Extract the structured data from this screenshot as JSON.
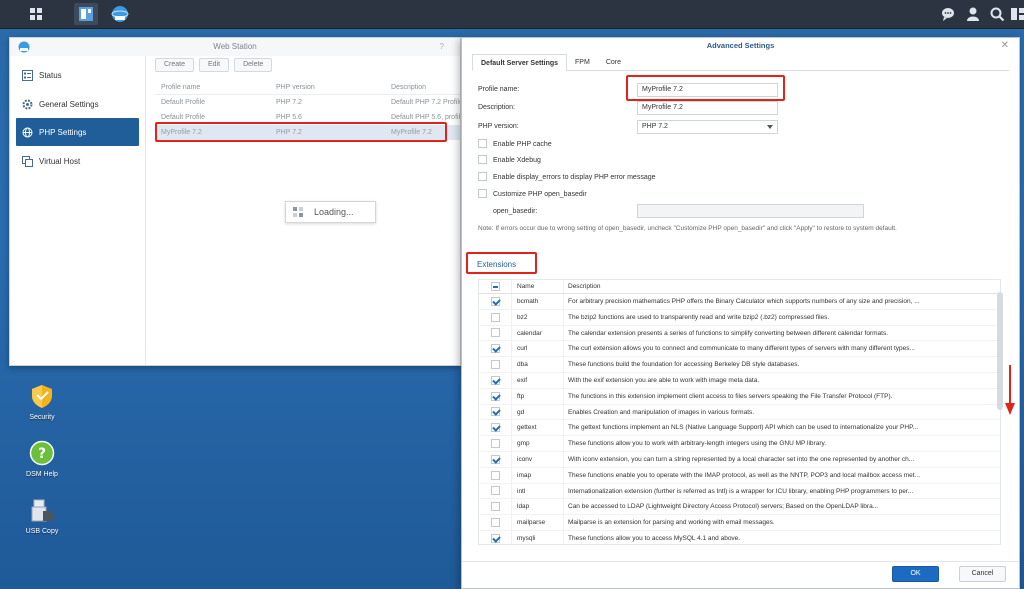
{
  "desktop": {
    "icons": [
      {
        "label": "Security"
      },
      {
        "label": "DSM Help"
      },
      {
        "label": "USB Copy"
      }
    ]
  },
  "web_station": {
    "title": "Web Station",
    "sidebar": [
      {
        "label": "Status"
      },
      {
        "label": "General Settings"
      },
      {
        "label": "PHP Settings"
      },
      {
        "label": "Virtual Host"
      }
    ],
    "toolbar": {
      "create": "Create",
      "edit": "Edit",
      "delete": "Delete"
    },
    "columns": [
      "Profile name",
      "PHP version",
      "Description"
    ],
    "rows": [
      [
        "Default Profile",
        "PHP 7.2",
        "Default PHP 7.2 Profile"
      ],
      [
        "Default Profile",
        "PHP 5.6",
        "Default PHP 5.6, profile"
      ],
      [
        "MyProfile 7.2",
        "PHP 7.2",
        "MyProfile 7.2"
      ]
    ],
    "loading": "Loading..."
  },
  "advanced": {
    "title": "Advanced Settings",
    "tabs": [
      "Default Server Settings",
      "FPM",
      "Core"
    ],
    "profile_name_label": "Profile name:",
    "profile_name_value": "MyProfile 7.2",
    "description_label": "Description:",
    "description_value": "MyProfile 7.2",
    "php_version_label": "PHP version:",
    "php_version_value": "PHP 7.2",
    "opt_cache": "Enable PHP cache",
    "opt_xdebug": "Enable Xdebug",
    "opt_display_errors": "Enable display_errors to display PHP error message",
    "opt_open_basedir": "Customize PHP open_basedir",
    "open_basedir_label": "open_basedir:",
    "note_prefix": "Note:",
    "note_text": "If errors occur due to wrong setting of open_basedir, uncheck \"Customize PHP open_basedir\" and click \"Apply\" to restore to system default.",
    "extensions_title": "Extensions",
    "ext_columns": [
      "Name",
      "Description"
    ],
    "extensions": [
      {
        "name": "bcmath",
        "checked": true,
        "desc": "For arbitrary precision mathematics PHP offers the Binary Calculator which supports numbers of any size and precision, ..."
      },
      {
        "name": "bz2",
        "checked": false,
        "desc": "The bzip2 functions are used to transparently read and write bzip2 (.bz2) compressed files."
      },
      {
        "name": "calendar",
        "checked": false,
        "desc": "The calendar extension presents a series of functions to simplify converting between different calendar formats."
      },
      {
        "name": "curl",
        "checked": true,
        "desc": "The curl extension allows you to connect and communicate to many different types of servers with many different types..."
      },
      {
        "name": "dba",
        "checked": false,
        "desc": "These functions build the foundation for accessing Berkeley DB style databases."
      },
      {
        "name": "exif",
        "checked": true,
        "desc": "With the exif extension you are able to work with image meta data."
      },
      {
        "name": "ftp",
        "checked": true,
        "desc": "The functions in this extension implement client access to files servers speaking the File Transfer Protocol (FTP)."
      },
      {
        "name": "gd",
        "checked": true,
        "desc": "Enables Creation and manipulation of images in various formats."
      },
      {
        "name": "gettext",
        "checked": true,
        "desc": "The gettext functions implement an NLS (Native Language Support) API which can be used to internationalize your PHP..."
      },
      {
        "name": "gmp",
        "checked": false,
        "desc": "These functions allow you to work with arbitrary-length integers using the GNU MP library."
      },
      {
        "name": "iconv",
        "checked": true,
        "desc": "With iconv extension, you can turn a string represented by a local character set into the one represented by another ch..."
      },
      {
        "name": "imap",
        "checked": false,
        "desc": "These functions enable you to operate with the IMAP protocol, as well as the NNTP, POP3 and local mailbox access met..."
      },
      {
        "name": "intl",
        "checked": false,
        "desc": "Internationalization extension (further is referred as Intl) is a wrapper for ICU library, enabling PHP programmers to per..."
      },
      {
        "name": "ldap",
        "checked": false,
        "desc": "Can be accessed to LDAP (Lightweight Directory Access Protocol) servers; Based on the OpenLDAP libra..."
      },
      {
        "name": "mailparse",
        "checked": false,
        "desc": "Mailparse is an extension for parsing and working with email messages."
      },
      {
        "name": "mysqli",
        "checked": true,
        "desc": "These functions allow you to access MySQL 4.1 and above."
      }
    ],
    "ok": "OK",
    "cancel": "Cancel"
  },
  "colors": {
    "accent": "#1f5e98",
    "highlight": "#e2231a"
  }
}
